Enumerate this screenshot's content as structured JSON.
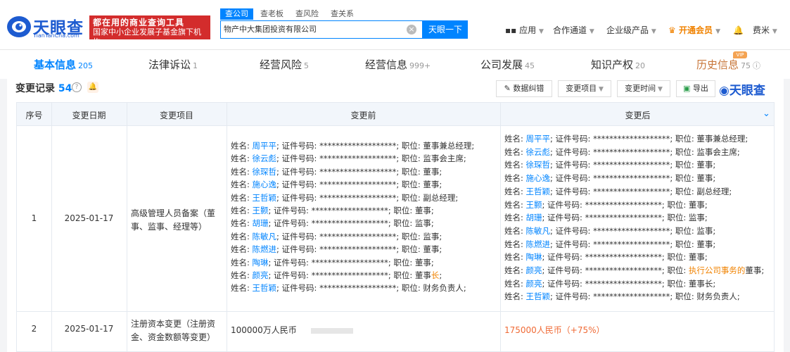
{
  "header": {
    "logo_text": "天眼查",
    "logo_sub": "TianYanCha.com",
    "slogan_line1": "都在用的商业查询工具",
    "slogan_line2": "国家中小企业发展子基金旗下机构",
    "search_tabs": [
      "查公司",
      "查老板",
      "查风险",
      "查关系"
    ],
    "search_value": "物产中大集团投资有限公司",
    "search_button": "天眼一下",
    "nav": {
      "app": "应用",
      "channel": "合作通道",
      "enterprise": "企业级产品",
      "vip": "开通会员",
      "user": "费米"
    }
  },
  "tabs": [
    {
      "label": "基本信息",
      "count": "205"
    },
    {
      "label": "法律诉讼",
      "count": "1"
    },
    {
      "label": "经营风险",
      "count": "5"
    },
    {
      "label": "经营信息",
      "count": "999+"
    },
    {
      "label": "公司发展",
      "count": "45"
    },
    {
      "label": "知识产权",
      "count": "20"
    },
    {
      "label": "历史信息",
      "count": "75"
    }
  ],
  "vip_badge": "VIP",
  "section": {
    "title": "变更记录",
    "count": "54",
    "buttons": {
      "correct": "数据纠错",
      "item": "变更项目",
      "time": "变更时间",
      "export": "导出"
    },
    "brand": "天眼查"
  },
  "table": {
    "headers": [
      "序号",
      "变更日期",
      "变更项目",
      "变更前",
      "变更后"
    ],
    "rows": [
      {
        "no": "1",
        "date": "2025-01-17",
        "item": "高级管理人员备案（董事、监事、经理等）",
        "before": [
          {
            "name": "周平平",
            "pos": "董事兼总经理"
          },
          {
            "name": "徐云彪",
            "pos": "监事会主席"
          },
          {
            "name": "徐琛哲",
            "pos": "董事"
          },
          {
            "name": "施心逸",
            "pos": "董事"
          },
          {
            "name": "王哲颖",
            "pos": "副总经理"
          },
          {
            "name": "王颢",
            "pos": "董事"
          },
          {
            "name": "胡珊",
            "pos": "监事"
          },
          {
            "name": "陈敏凡",
            "pos": "监事"
          },
          {
            "name": "陈燃进",
            "pos": "董事"
          },
          {
            "name": "陶琳",
            "pos": "董事"
          },
          {
            "name": "颜亮",
            "pos_pre": "董事",
            "pos_hl": "长"
          },
          {
            "name": "王哲颖",
            "pos": "财务负责人"
          }
        ],
        "after": [
          {
            "name": "周平平",
            "pos": "董事兼总经理"
          },
          {
            "name": "徐云彪",
            "pos": "监事会主席"
          },
          {
            "name": "徐琛哲",
            "pos": "董事"
          },
          {
            "name": "施心逸",
            "pos": "董事"
          },
          {
            "name": "王哲颖",
            "pos": "副总经理"
          },
          {
            "name": "王颢",
            "pos": "董事"
          },
          {
            "name": "胡珊",
            "pos": "监事"
          },
          {
            "name": "陈敏凡",
            "pos": "监事"
          },
          {
            "name": "陈燃进",
            "pos": "董事"
          },
          {
            "name": "陶琳",
            "pos": "董事"
          },
          {
            "name": "颜亮",
            "pos_hl": "执行公司事务的",
            "pos_post": "董事"
          },
          {
            "name": "颜亮",
            "pos": "董事长"
          },
          {
            "name": "王哲颖",
            "pos": "财务负责人"
          }
        ]
      },
      {
        "no": "2",
        "date": "2025-01-17",
        "item": "注册资本变更（注册资金、资金数额等变更）",
        "before_text": "100000万人民币",
        "after_text": "175000人民币（+75%）"
      }
    ],
    "labels": {
      "name": "姓名",
      "cert": "证件号码",
      "mask": "*******************",
      "pos": "职位"
    }
  }
}
